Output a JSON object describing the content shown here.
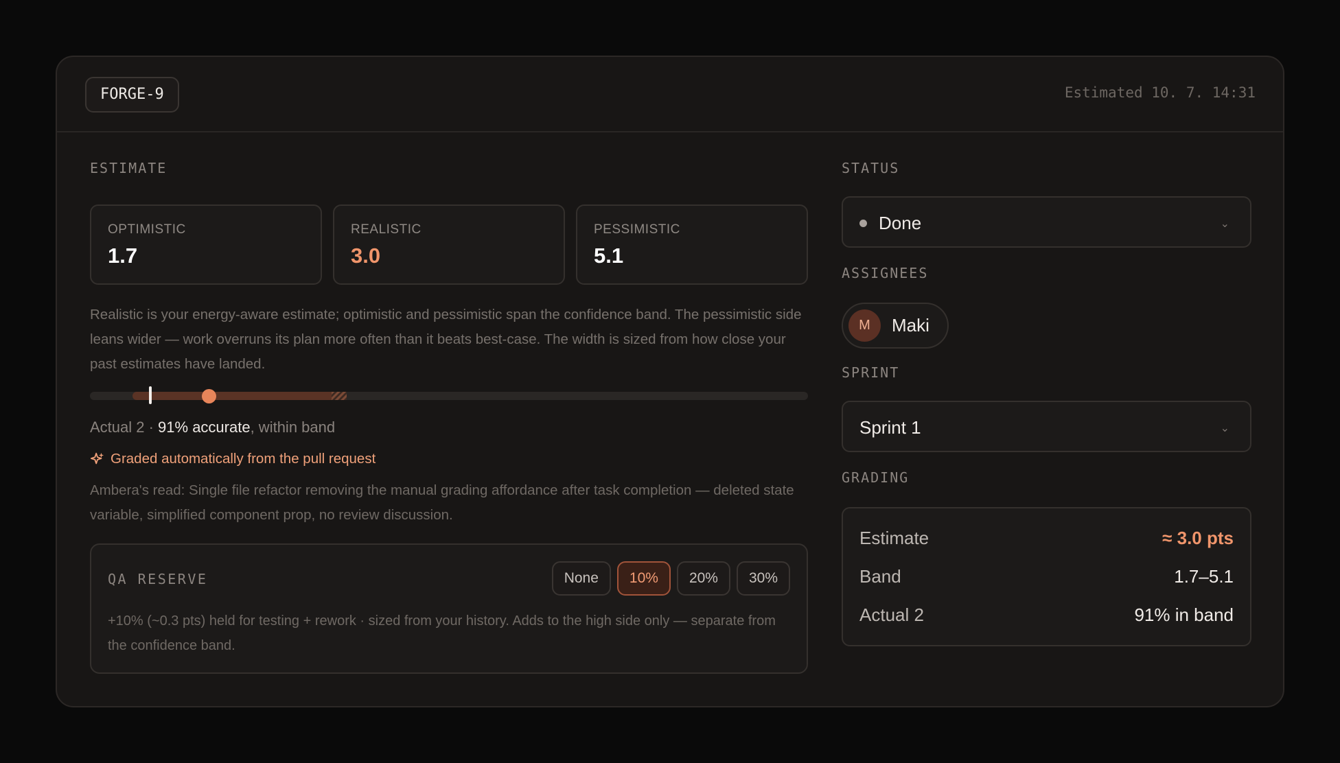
{
  "header": {
    "ticket_id": "FORGE-9",
    "estimated_at": "Estimated 10. 7. 14:31"
  },
  "estimate": {
    "section_label": "ESTIMATE",
    "optimistic": {
      "label": "OPTIMISTIC",
      "value": "1.7"
    },
    "realistic": {
      "label": "REALISTIC",
      "value": "3.0"
    },
    "pessimistic": {
      "label": "PESSIMISTIC",
      "value": "5.1"
    },
    "description": "Realistic is your energy-aware estimate; optimistic and pessimistic span the confidence band. The pessimistic side leans wider — work overruns its plan more often than it beats best-case. The width is sized from how close your past estimates have landed.",
    "accuracy_prefix": "Actual 2 · ",
    "accuracy_highlight": "91% accurate",
    "accuracy_suffix": ", within band",
    "graded_text": "Graded automatically from the pull request",
    "read_text": "Ambera's read: Single file refactor removing the manual grading affordance after task completion — deleted state variable, simplified component prop, no review discussion.",
    "accent_color": "#e8855a"
  },
  "qa_reserve": {
    "label": "QA RESERVE",
    "options": [
      "None",
      "10%",
      "20%",
      "30%"
    ],
    "selected": "10%",
    "description": "+10% (~0.3 pts) held for testing + rework · sized from your history. Adds to the high side only — separate from the confidence band."
  },
  "status": {
    "label": "STATUS",
    "value": "Done"
  },
  "assignees": {
    "label": "ASSIGNEES",
    "items": [
      {
        "initial": "M",
        "name": "Maki"
      }
    ]
  },
  "sprint": {
    "label": "SPRINT",
    "value": "Sprint 1"
  },
  "grading": {
    "label": "GRADING",
    "rows": [
      {
        "key": "Estimate",
        "value": "≈ 3.0 pts"
      },
      {
        "key": "Band",
        "value": "1.7–5.1"
      },
      {
        "key": "Actual 2",
        "value": "91% in band"
      }
    ]
  }
}
